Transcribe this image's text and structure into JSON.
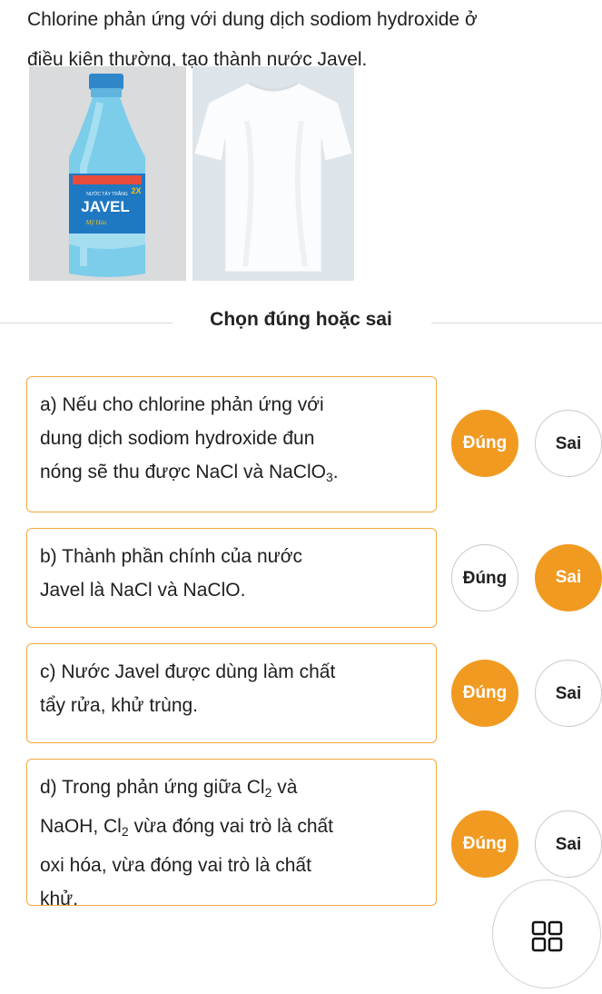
{
  "intro": {
    "line1": "Chlorine phản ứng với dung dịch sodiom hydroxide ở",
    "line2": "điều kiện thường, tạo thành nước Javel."
  },
  "images": {
    "bottle_brand": "JAVEL",
    "bottle_small": "NƯỚC TẨY TRẮNG",
    "bottle_sub": "Mỹ Hảo",
    "bottle_badge": "2X"
  },
  "section_title": "Chọn đúng hoặc sai",
  "buttons": {
    "true_label": "Đúng",
    "false_label": "Sai"
  },
  "questions": [
    {
      "lines": [
        "a) Nếu cho chlorine phản ứng với",
        "dung dịch sodiom hydroxide đun",
        "nóng sẽ thu được NaCl và NaClO"
      ],
      "sub": "3",
      "tail": ".",
      "selected": "true"
    },
    {
      "lines": [
        "b) Thành phần chính của nước",
        "Javel là NaCl và NaClO."
      ],
      "selected": "false"
    },
    {
      "lines": [
        "c) Nước Javel được dùng làm chất",
        "tẩy rửa, khử trùng."
      ],
      "selected": "true"
    },
    {
      "line1_pre": "d) Trong phản ứng giữa Cl",
      "line1_sub": "2",
      "line1_post": " và",
      "line2_pre": "NaOH, Cl",
      "line2_sub": "2",
      "line2_post": " vừa đóng vai trò là chất",
      "line3": "oxi hóa, vừa đóng vai trò là chất",
      "line4": "khử.",
      "selected": "true"
    }
  ],
  "fab_icon": "grid-icon",
  "colors": {
    "accent": "#f19a21",
    "card_border": "#f2a93b"
  }
}
